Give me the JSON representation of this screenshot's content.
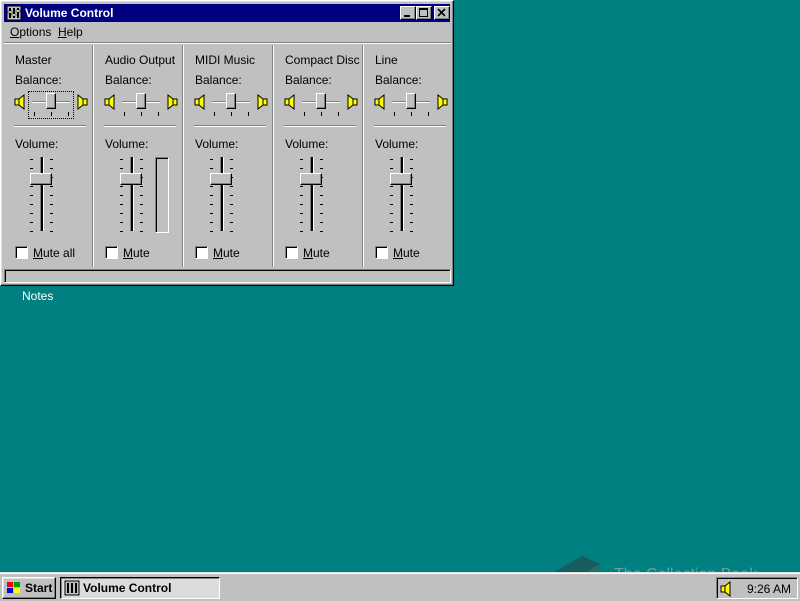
{
  "window": {
    "title": "Volume Control",
    "menu": [
      {
        "label": "Options",
        "underline": "O"
      },
      {
        "label": "Help",
        "underline": "H"
      }
    ]
  },
  "labels": {
    "balance": "Balance:",
    "volume": "Volume:"
  },
  "channels": [
    {
      "name": "Master",
      "mute_label": "Mute all",
      "balance_level": 0.5,
      "volume_level": 0.75,
      "has_meter": false,
      "focused": true
    },
    {
      "name": "Audio Output",
      "mute_label": "Mute",
      "balance_level": 0.5,
      "volume_level": 0.75,
      "has_meter": true,
      "focused": false
    },
    {
      "name": "MIDI Music",
      "mute_label": "Mute",
      "balance_level": 0.5,
      "volume_level": 0.75,
      "has_meter": false,
      "focused": false
    },
    {
      "name": "Compact Disc",
      "mute_label": "Mute",
      "balance_level": 0.5,
      "volume_level": 0.75,
      "has_meter": false,
      "focused": false
    },
    {
      "name": "Line",
      "mute_label": "Mute",
      "balance_level": 0.5,
      "volume_level": 0.75,
      "has_meter": false,
      "focused": false
    }
  ],
  "desktop": {
    "icon_label": "Notes"
  },
  "watermark": {
    "text": "The Collection Book",
    "icon": "book-icon"
  },
  "taskbar": {
    "start_label": "Start",
    "tasks": [
      {
        "label": "Volume Control",
        "active": true
      }
    ],
    "clock": "9:26 AM",
    "tray_icon": "speaker-icon"
  },
  "colors": {
    "desktop": "#008080",
    "titlebar": "#000080",
    "face": "#c0c0c0"
  }
}
